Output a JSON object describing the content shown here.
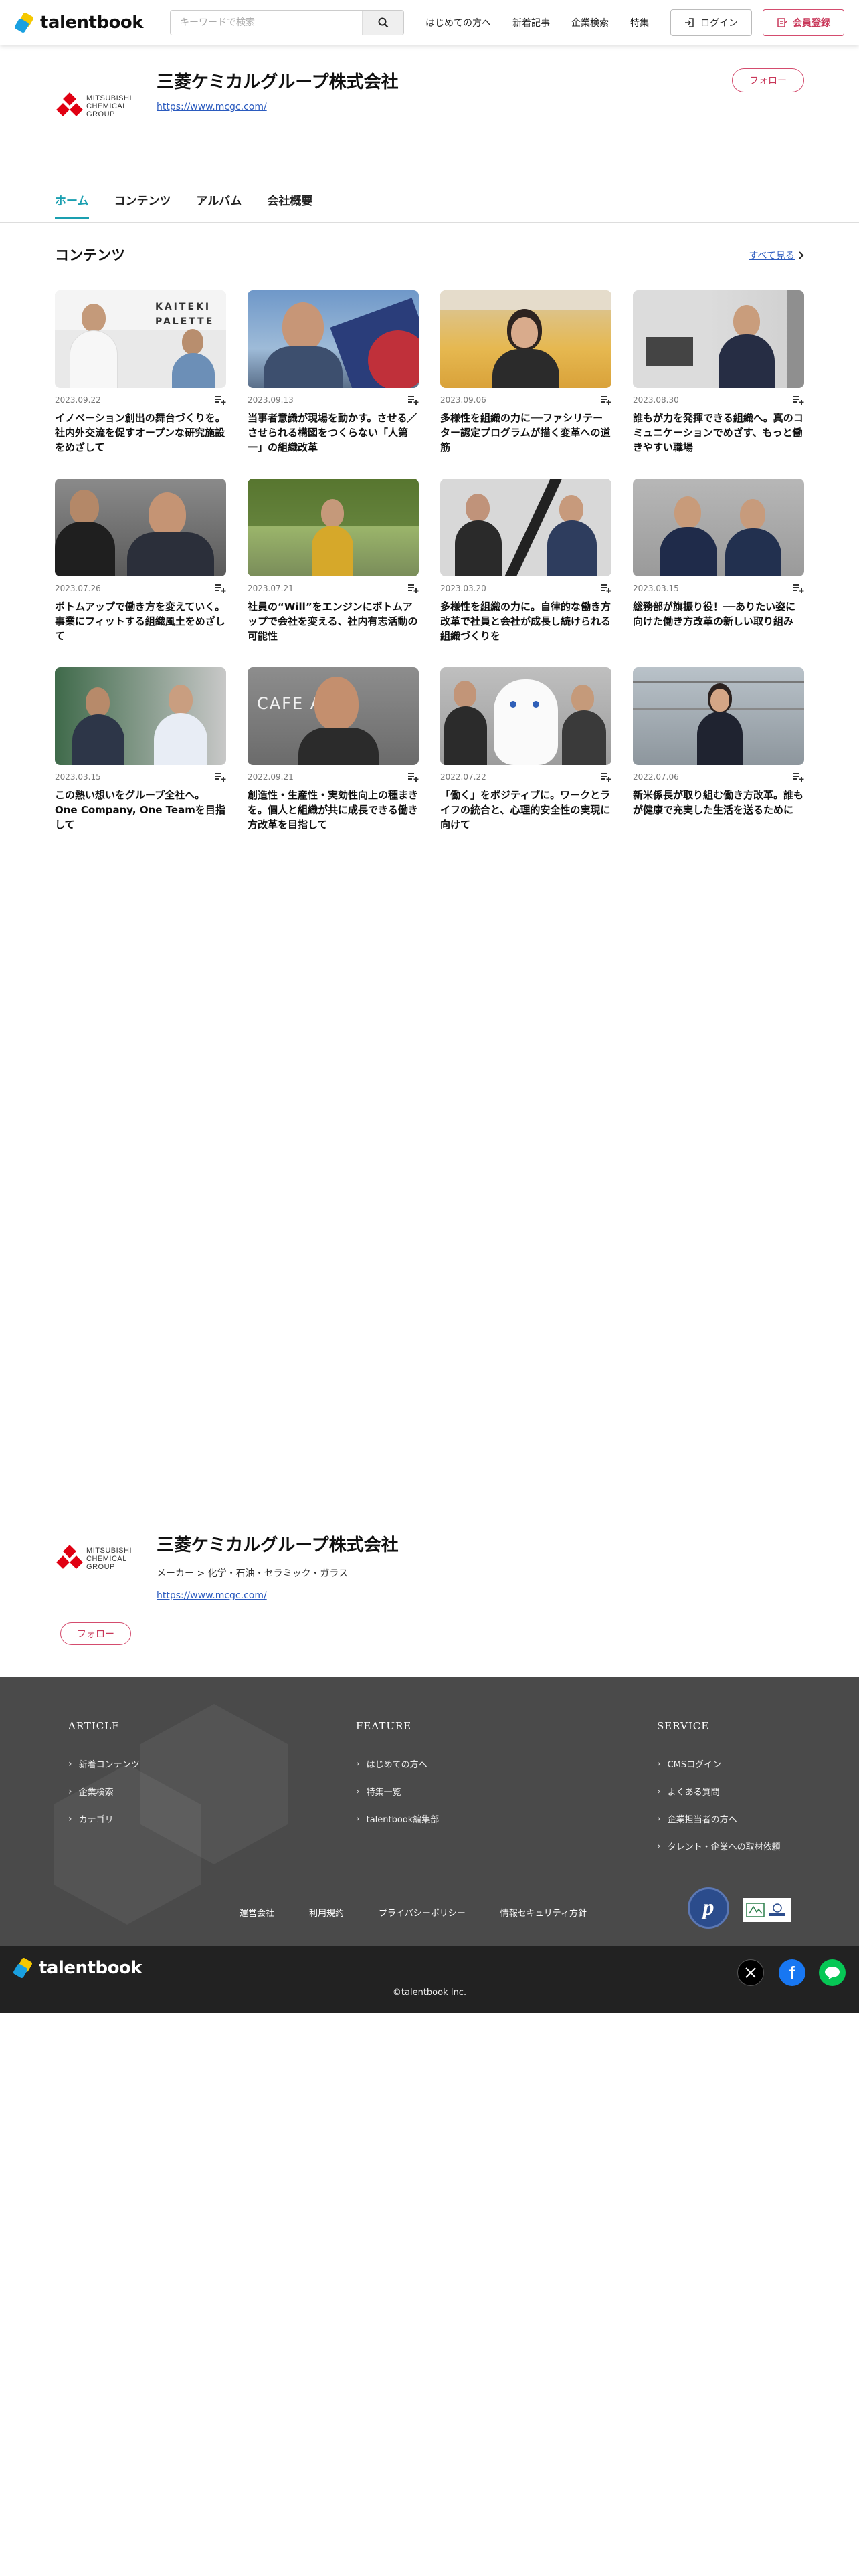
{
  "header": {
    "logo_text": "talentbook",
    "search_placeholder": "キーワードで検索",
    "nav": [
      "はじめての方へ",
      "新着記事",
      "企業検索",
      "特集"
    ],
    "login_label": "ログイン",
    "register_label": "会員登録"
  },
  "company": {
    "name": "三菱ケミカルグループ株式会社",
    "url": "https://www.mcgc.com/",
    "logo_lines": [
      "MITSUBISHI",
      "CHEMICAL",
      "GROUP"
    ],
    "follow_label": "フォロー",
    "category": "メーカー > 化学・石油・セラミック・ガラス"
  },
  "tabs": [
    {
      "label": "ホーム",
      "active": true
    },
    {
      "label": "コンテンツ",
      "active": false
    },
    {
      "label": "アルバム",
      "active": false
    },
    {
      "label": "会社概要",
      "active": false
    }
  ],
  "contents": {
    "title": "コンテンツ",
    "see_all": "すべて見る",
    "items": [
      {
        "date": "2023.09.22",
        "title": "イノベーション創出の舞台づくりを。社内外交流を促すオープンな研究施設をめざして",
        "thumb_text": "KAITEKI PALETTE"
      },
      {
        "date": "2023.09.13",
        "title": "当事者意識が現場を動かす。させる／させられる構図をつくらない「人第一」の組織改革",
        "thumb_text": ""
      },
      {
        "date": "2023.09.06",
        "title": "多様性を組織の力に──ファシリテーター認定プログラムが描く変革への道筋",
        "thumb_text": ""
      },
      {
        "date": "2023.08.30",
        "title": "誰もが力を発揮できる組織へ。真のコミュニケーションでめざす、もっと働きやすい職場",
        "thumb_text": ""
      },
      {
        "date": "2023.07.26",
        "title": "ボトムアップで働き方を変えていく。事業にフィットする組織風土をめざして",
        "thumb_text": ""
      },
      {
        "date": "2023.07.21",
        "title": "社員の“Will”をエンジンにボトムアップで会社を変える、社内有志活動の可能性",
        "thumb_text": ""
      },
      {
        "date": "2023.03.20",
        "title": "多様性を組織の力に。自律的な働き方改革で社員と会社が成長し続けられる組織づくりを",
        "thumb_text": ""
      },
      {
        "date": "2023.03.15",
        "title": "総務部が旗振り役！──ありたい姿に向けた働き方改革の新しい取り組み",
        "thumb_text": ""
      },
      {
        "date": "2023.03.15",
        "title": "この熱い想いをグループ全社へ。One Company, One Teamを目指して",
        "thumb_text": ""
      },
      {
        "date": "2022.09.21",
        "title": "創造性・生産性・実効性向上の種まきを。個人と組織が共に成長できる働き方改革を目指して",
        "thumb_text": "CAFE ACE"
      },
      {
        "date": "2022.07.22",
        "title": "「働く」をポジティブに。ワークとライフの統合と、心理的安全性の実現に向けて",
        "thumb_text": ""
      },
      {
        "date": "2022.07.06",
        "title": "新米係長が取り組む働き方改革。誰もが健康で充実した生活を送るために",
        "thumb_text": ""
      }
    ]
  },
  "footer": {
    "columns": [
      {
        "heading": "ARTICLE",
        "items": [
          "新着コンテンツ",
          "企業検索",
          "カテゴリ"
        ]
      },
      {
        "heading": "FEATURE",
        "items": [
          "はじめての方へ",
          "特集一覧",
          "talentbook編集部"
        ]
      },
      {
        "heading": "SERVICE",
        "items": [
          "CMSログイン",
          "よくある質問",
          "企業担当者の方へ",
          "タレント・企業への取材依頼"
        ]
      }
    ],
    "links": [
      "運営会社",
      "利用規約",
      "プライバシーポリシー",
      "情報セキュリティ方針"
    ],
    "copyright": "©talentbook Inc."
  },
  "colors": {
    "accent": "#1a9fb0",
    "follow": "#c9385a",
    "link": "#2b5bbf",
    "footer_bg": "#4a4a4a",
    "bottom_bg": "#222222"
  }
}
